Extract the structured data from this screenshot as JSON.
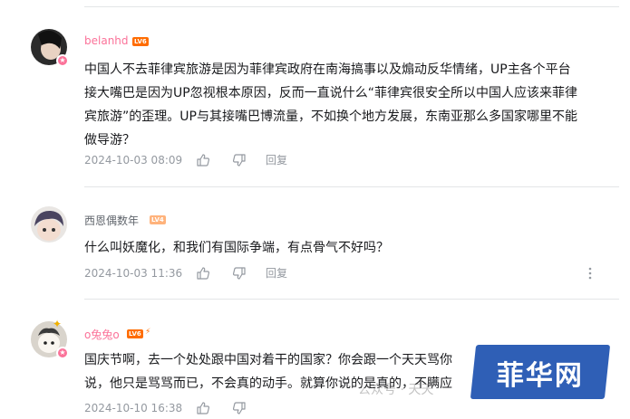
{
  "comments": [
    {
      "username": "belanhd",
      "level": "LV6",
      "name_color": "#fb7299",
      "text": "中国人不去菲律宾旅游是因为菲律宾政府在南海搞事以及煽动反华情绪，UP主各个平台\n接大嘴巴是因为UP忽视根本原因，反而一直说什么“菲律宾很安全所以中国人应该来菲律\n宾旅游”的歪理。UP与其接嘴巴博流量，不如换个地方发展，东南亚那么多国家哪里不能\n做导游？",
      "date": "2024-10-03 08:09",
      "reply": "回复"
    },
    {
      "username": "西恩偶数年",
      "level": "LV4",
      "name_color": "#61666d",
      "text": "什么叫妖魔化，和我们有国际争端，有点骨气不好吗？",
      "date": "2024-10-03 11:36",
      "reply": "回复"
    },
    {
      "username": "o兔兔o",
      "level": "LV6",
      "name_color": "#fb7299",
      "text": "国庆节啊，去一个处处跟中国对着干的国家？你会跟一个天天骂你\n说，他只是骂骂而已，不会真的动手。就算你说的是真的，不瞒应",
      "date": "2024-10-10 16:38",
      "reply": "回复"
    }
  ],
  "watermark": "公众号 · 天天",
  "logo_text": "菲华网",
  "colors": {
    "pink": "#fb7299",
    "lv6": "#ff6c00",
    "lv4": "#ffb37c",
    "meta": "#9499a0"
  }
}
